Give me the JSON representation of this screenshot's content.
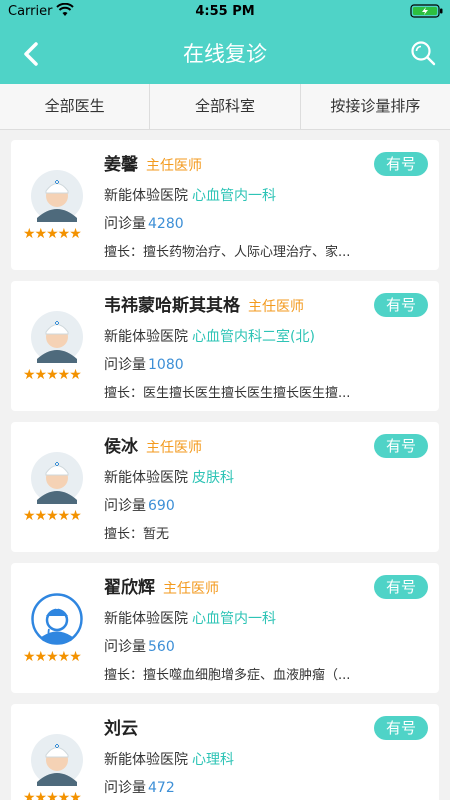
{
  "status_bar": {
    "carrier": "Carrier",
    "time": "4:55 PM"
  },
  "nav": {
    "title": "在线复诊",
    "back_icon": "chevron-left-icon",
    "search_icon": "search-icon"
  },
  "filters": [
    "全部医生",
    "全部科室",
    "按接诊量排序"
  ],
  "colors": {
    "primary": "#4fd3c7",
    "title_badge": "#f39a1e",
    "department": "#2ec4b6",
    "count": "#3d8fd6",
    "star": "#f39200"
  },
  "doctors": [
    {
      "name": "姜馨",
      "title": "主任医师",
      "hospital": "新能体验医院",
      "department": "心血管内一科",
      "consult_label": "问诊量",
      "consult_count": "4280",
      "skill": "擅长：擅长药物治疗、人际心理治疗、家...",
      "available": "有号",
      "stars": "★★★★★"
    },
    {
      "name": "韦祎蒙哈斯其其格",
      "title": "主任医师",
      "hospital": "新能体验医院",
      "department": "心血管内科二室(北)",
      "consult_label": "问诊量",
      "consult_count": "1080",
      "skill": "擅长：医生擅长医生擅长医生擅长医生擅...",
      "available": "有号",
      "stars": "★★★★★"
    },
    {
      "name": "侯冰",
      "title": "主任医师",
      "hospital": "新能体验医院",
      "department": "皮肤科",
      "consult_label": "问诊量",
      "consult_count": "690",
      "skill": "擅长：暂无",
      "available": "有号",
      "stars": "★★★★★"
    },
    {
      "name": "翟欣辉",
      "title": "主任医师",
      "hospital": "新能体验医院",
      "department": "心血管内一科",
      "consult_label": "问诊量",
      "consult_count": "560",
      "skill": "擅长：擅长噬血细胞增多症、血液肿瘤（...",
      "available": "有号",
      "stars": "★★★★★"
    },
    {
      "name": "刘云",
      "title": "",
      "hospital": "新能体验医院",
      "department": "心理科",
      "consult_label": "问诊量",
      "consult_count": "472",
      "skill": "",
      "available": "有号",
      "stars": "★★★★★"
    }
  ]
}
